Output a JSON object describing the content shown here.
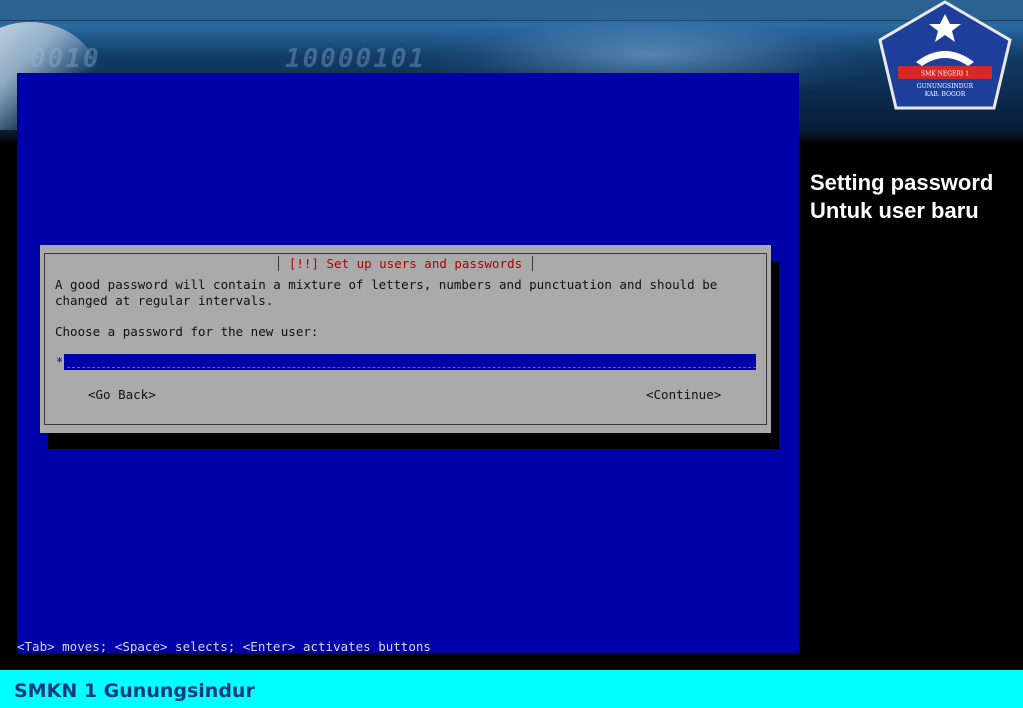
{
  "installer": {
    "dialog_title": "[!!] Set up users and passwords",
    "message_line1": "A good password will contain a mixture of letters, numbers and punctuation and should be",
    "message_line2": "changed at regular intervals.",
    "prompt": "Choose a password for the new user:",
    "password_value": "*",
    "go_back_label": "<Go Back>",
    "continue_label": "<Continue>",
    "hint": "<Tab> moves; <Space> selects; <Enter> activates buttons"
  },
  "slide": {
    "caption_line1": "Setting password",
    "caption_line2": "Untuk user baru",
    "footer": "SMKN 1 Gunungsindur",
    "banner_bits_left": "0010",
    "banner_bits_mid": "10000101"
  },
  "logo": {
    "icon": "school-emblem-icon",
    "ribbon_text": "SMK NEGERI 1",
    "line1": "GUNUNGSINDUR",
    "line2": "KAB. BOGOR",
    "colors": {
      "shield": "#1d3f9a",
      "ribbon": "#d62828",
      "star": "#ffffff"
    }
  },
  "colors": {
    "terminal_bg": "#0000a8",
    "dialog_bg": "#aaaaaa",
    "title_red": "#b00000",
    "footer_bg": "#00ffff"
  }
}
